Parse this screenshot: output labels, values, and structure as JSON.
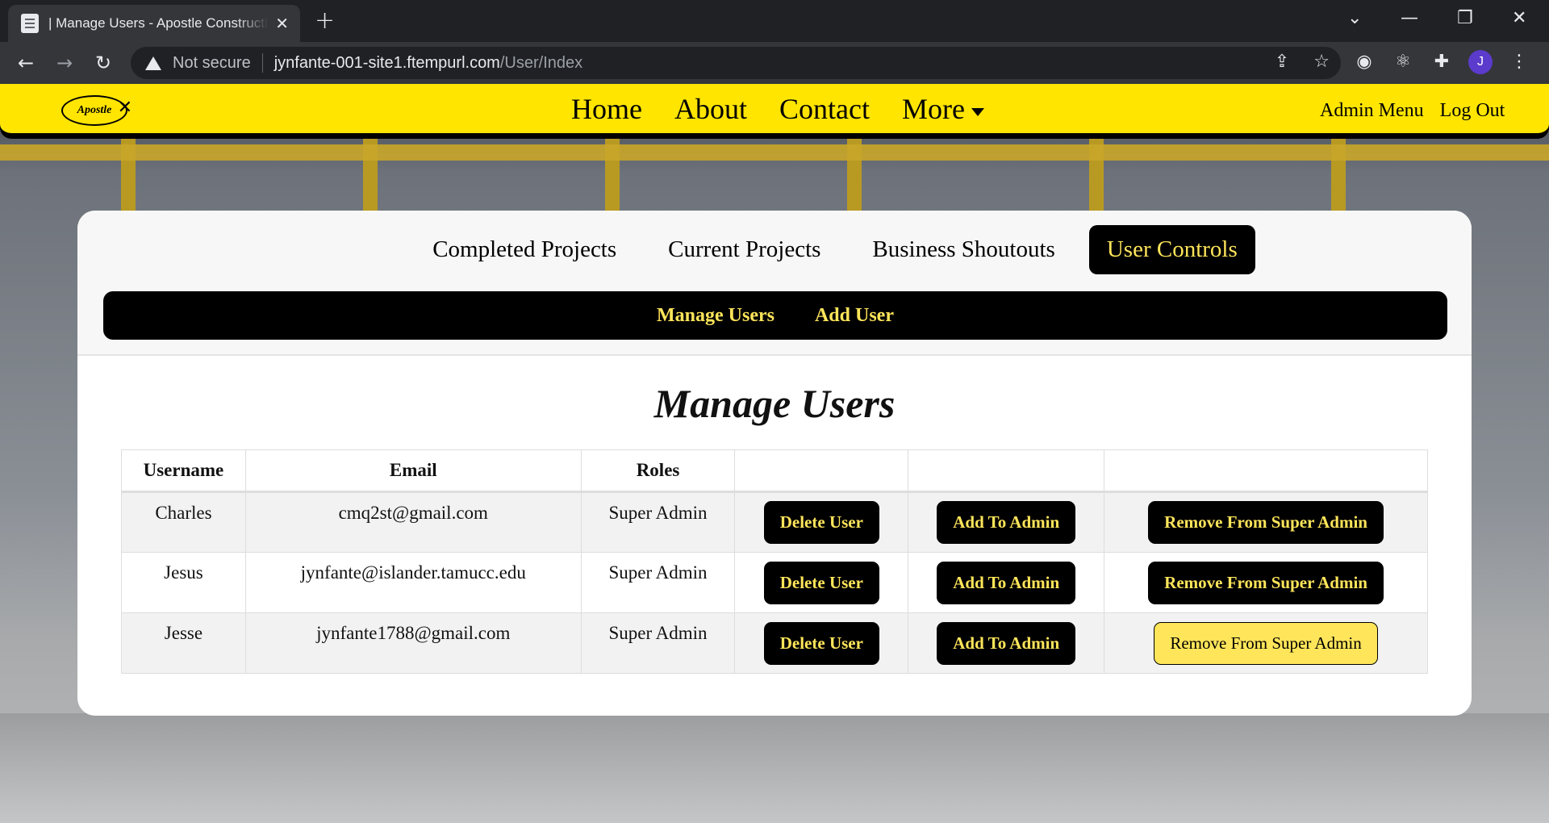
{
  "browser": {
    "tab_title": "| Manage Users - Apostle Construction",
    "tab_close": "✕",
    "new_tab": "+",
    "not_secure": "Not secure",
    "url_host": "jynfante-001-site1.ftempurl.com",
    "url_path": "/User/Index",
    "avatar_letter": "J",
    "window_controls": {
      "dropdown": "⌄",
      "minimize": "—",
      "restore": "❐",
      "close": "✕"
    }
  },
  "site_nav": {
    "logo_text": "Apostle",
    "links": [
      "Home",
      "About",
      "Contact",
      "More"
    ],
    "admin_links": [
      "Admin Menu",
      "Log Out"
    ]
  },
  "tabs": [
    "Completed Projects",
    "Current Projects",
    "Business Shoutouts",
    "User Controls"
  ],
  "active_tab": "User Controls",
  "subnav": [
    "Manage Users",
    "Add User"
  ],
  "page_title": "Manage Users",
  "table": {
    "headers": [
      "Username",
      "Email",
      "Roles",
      "",
      "",
      ""
    ],
    "rows": [
      {
        "username": "Charles",
        "email": "cmq2st@gmail.com",
        "roles": "Super Admin",
        "delete": "Delete User",
        "add_admin": "Add To Admin",
        "remove_super": "Remove From Super Admin"
      },
      {
        "username": "Jesus",
        "email": "jynfante@islander.tamucc.edu",
        "roles": "Super Admin",
        "delete": "Delete User",
        "add_admin": "Add To Admin",
        "remove_super": "Remove From Super Admin"
      },
      {
        "username": "Jesse",
        "email": "jynfante1788@gmail.com",
        "roles": "Super Admin",
        "delete": "Delete User",
        "add_admin": "Add To Admin",
        "remove_super": "Remove From Super Admin"
      }
    ]
  },
  "colors": {
    "nav_yellow": "#ffe500",
    "accent_yellow": "#ffe55a",
    "black": "#000000"
  }
}
